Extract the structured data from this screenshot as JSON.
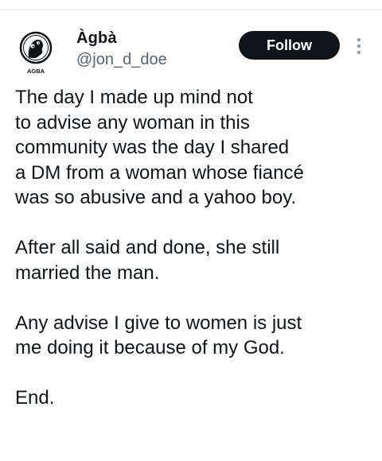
{
  "author": {
    "display_name": "Àgbà",
    "handle": "@jon_d_doe",
    "avatar_caption": "AGBA"
  },
  "actions": {
    "follow_label": "Follow",
    "more_icon": "more-vertical-icon"
  },
  "tweet": {
    "paragraphs": [
      {
        "lines": [
          "The day I made up mind not",
          "to advise any woman in this",
          "community was the day I shared",
          "a DM from a woman whose fiancé",
          "was so abusive and a yahoo boy."
        ]
      },
      {
        "lines": [
          "After all said and done, she still",
          "married the man."
        ]
      },
      {
        "lines": [
          "Any advise I give to women is just",
          "me doing it because of my God."
        ]
      },
      {
        "lines": [
          "End."
        ]
      }
    ]
  },
  "colors": {
    "text_primary": "#0f1419",
    "text_secondary": "#536471",
    "button_bg": "#0f1419",
    "button_text": "#ffffff",
    "divider": "#e6e9eb"
  }
}
